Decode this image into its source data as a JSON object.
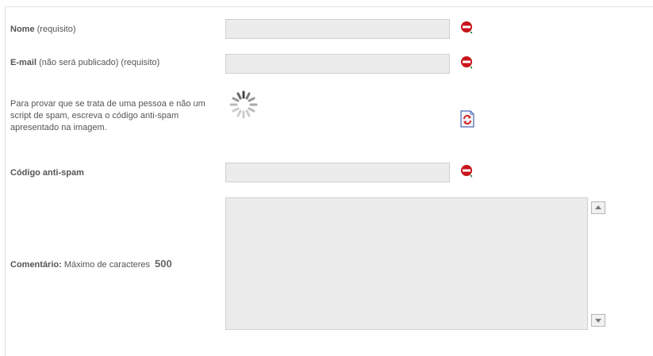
{
  "form": {
    "name": {
      "label_bold": "Nome",
      "label_rest": " (requisito)",
      "value": ""
    },
    "email": {
      "label_bold": "E-mail",
      "label_rest": " (não será publicado) (requisito)",
      "value": ""
    },
    "captcha": {
      "instructions": "Para provar que se trata de uma pessoa e não um script de spam, escreva o código anti-spam apresentado na imagem."
    },
    "antispam": {
      "label_bold": "Código anti-spam",
      "value": ""
    },
    "comment": {
      "label_bold": "Comentário:",
      "label_rest": " Máximo de caracteres",
      "max_chars": "500",
      "value": ""
    }
  },
  "icons": {
    "required": "required-icon",
    "refresh": "refresh-captcha-icon",
    "loading": "loading-spinner-icon"
  },
  "colors": {
    "required_red": "#c8141b",
    "field_bg": "#ececec",
    "text": "#555555"
  }
}
